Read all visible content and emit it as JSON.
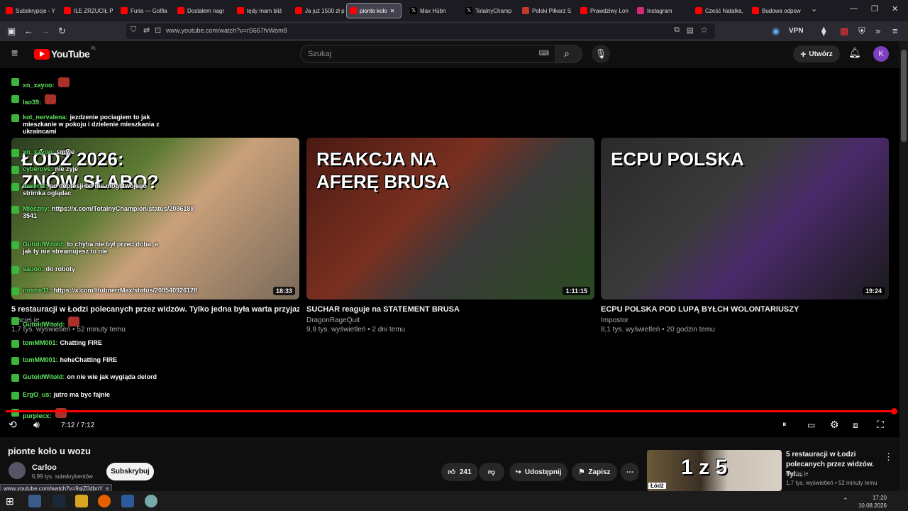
{
  "browser": {
    "tabs": [
      {
        "label": "Subskrypcje - Y",
        "color": "#ff0000"
      },
      {
        "label": "ILE ZRZUCIŁ P",
        "color": "#ff0000"
      },
      {
        "label": "Furia — Golfia",
        "color": "#ff0000"
      },
      {
        "label": "Dostałem nagr",
        "color": "#ff0000"
      },
      {
        "label": "tędy mam bliż",
        "color": "#ff0000"
      },
      {
        "label": "Ja już 1500 zł p",
        "color": "#ff0000"
      },
      {
        "label": "pionte koło",
        "color": "#ff0000",
        "active": true
      },
      {
        "label": "Max Hübn",
        "color": "#000000"
      },
      {
        "label": "TotalnyChamp",
        "color": "#000000"
      },
      {
        "label": "Polski Piłkarz S",
        "color": "#c0392b"
      },
      {
        "label": "Prawdziwy Lon",
        "color": "#ff0000"
      },
      {
        "label": "Instagram",
        "color": "#d62976"
      },
      {
        "label": "Cześć Natalka,",
        "color": "#ff0000"
      },
      {
        "label": "Budowa odpow",
        "color": "#ff0000"
      }
    ],
    "url": "www.youtube.com/watch?v=rS667fvWom8",
    "vpn_label": "VPN"
  },
  "youtube": {
    "logo": "YouTube",
    "region": "PL",
    "search_placeholder": "Szukaj",
    "create_label": "Utwórz",
    "avatar_letter": "K"
  },
  "endscreen": [
    {
      "title": "5 restauracji w Łodzi polecanych przez widzów. Tylko jedna była warta przyjazdu?",
      "channel": "Maciej je",
      "meta": "1,7 tys. wyświetleń • 52 minuty temu",
      "duration": "18:33",
      "thumb_text": "ŁÓDŹ 2026: ZNÓW SŁABO?"
    },
    {
      "title": "SUCHAR reaguje na STATEMENT BRUSA",
      "channel": "DragonRageQuit",
      "meta": "9,9 tys. wyświetleń • 2 dni temu",
      "duration": "1:11:15",
      "thumb_text": "REAKCJA NA AFERĘ BRUSA"
    },
    {
      "title": "ECPU POLSKA POD LUPĄ BYŁCH WOLONTARIUSZY",
      "channel": "Impostor",
      "meta": "8,1 tys. wyświetleń • 20 godzin temu",
      "duration": "19:24",
      "thumb_text": "ECPU POLSKA"
    }
  ],
  "chat": [
    {
      "user": "xn_xayoo:",
      "msg": ""
    },
    {
      "user": "lao39:",
      "msg": ""
    },
    {
      "user": "kot_nervalena:",
      "msg": "jezdzenie pociagiem to jak mieszkanie w pokoju i dzielenie mieszkania z ukraincami"
    },
    {
      "user": "xn_xayoo:",
      "msg": "smyle"
    },
    {
      "user": "cyberove:",
      "msg": "nie zyje"
    },
    {
      "user": "lowerst:",
      "msg": "po depresji bo nie mogl twojego strimka oglądac"
    },
    {
      "user": "Mleczny:",
      "msg": "https://x.com/TotalnyChampion/status/2086188 3541"
    },
    {
      "user": "GutoldWitold:",
      "msg": "to chyba nie był przed doba, a jak ty nie streamujesz to nie"
    },
    {
      "user": "sauoo:",
      "msg": "do roboty"
    },
    {
      "user": "nostor11:",
      "msg": "https://x.com/HubnerrMax/status/208540926128"
    },
    {
      "user": "GutoldWitold:",
      "msg": ""
    },
    {
      "user": "tomMM001:",
      "msg": "Chatting FIRE"
    },
    {
      "user": "tomMM001:",
      "msg": "heheChatting FIRE"
    },
    {
      "user": "GutoldWitold:",
      "msg": "on nie wie jak wygląda delord"
    },
    {
      "user": "ErgO_us:",
      "msg": "jutro ma byc fajnie"
    },
    {
      "user": "purplecx:",
      "msg": ""
    }
  ],
  "player": {
    "time": "7:12 / 7:12",
    "progress_fraction": 1.0
  },
  "video": {
    "title": "pionte koło u wozu",
    "channel": "Carloo",
    "subscribers": "6,99 tys. subskrybentów",
    "subscribe_label": "Subskrybuj",
    "likes": "241",
    "share_label": "Udostępnij",
    "save_label": "Zapisz"
  },
  "recommended": {
    "title": "5 restauracji w Łodzi polecanych przez widzów. Tyl...",
    "channel": "Maciej je",
    "meta": "1,7 tys. wyświetleń • 52 minuty temu",
    "thumb_text": "1 z 5",
    "thumb_tag": "Łódź"
  },
  "status_url": "www.youtube.com/watch?v=9qiZ0dbnY_s",
  "taskbar": {
    "time": "17:20",
    "date": "10.08.2026"
  }
}
